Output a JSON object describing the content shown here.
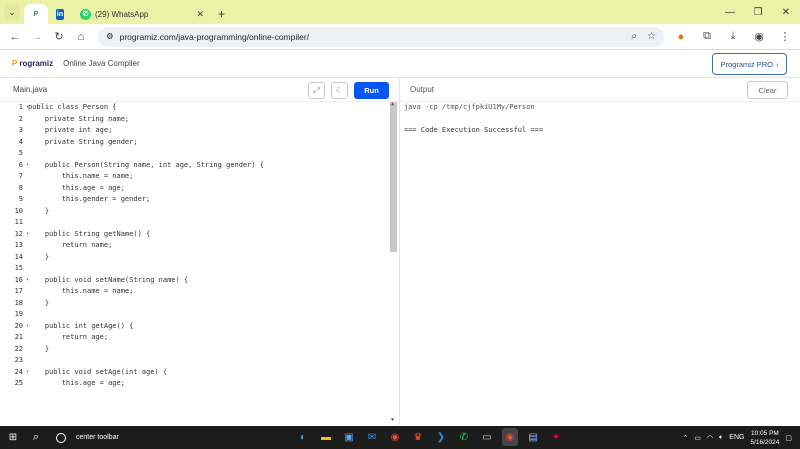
{
  "browser": {
    "tabs": [
      {
        "label": "",
        "icon": "programiz-favicon"
      },
      {
        "label": "",
        "icon": "linkedin-favicon"
      },
      {
        "label": "(29) WhatsApp",
        "icon": "whatsapp-favicon"
      }
    ],
    "new_tab": "+",
    "url": "programiz.com/java-programming/online-compiler/"
  },
  "app": {
    "logo_text": "rogramiz",
    "logo_prefix": "P",
    "title": "Online Java Compiler",
    "pro_button": "Programiz PRO",
    "pro_arrow": "›"
  },
  "editor": {
    "filename": "Main.java",
    "run_label": "Run",
    "lines": [
      {
        "n": "1",
        "fold": "▾",
        "text": "public class Person {"
      },
      {
        "n": "2",
        "fold": "",
        "text": "    private String name;"
      },
      {
        "n": "3",
        "fold": "",
        "text": "    private int age;"
      },
      {
        "n": "4",
        "fold": "",
        "text": "    private String gender;"
      },
      {
        "n": "5",
        "fold": "",
        "text": ""
      },
      {
        "n": "6",
        "fold": "▾",
        "text": "    public Person(String name, int age, String gender) {"
      },
      {
        "n": "7",
        "fold": "",
        "text": "        this.name = name;"
      },
      {
        "n": "8",
        "fold": "",
        "text": "        this.age = age;"
      },
      {
        "n": "9",
        "fold": "",
        "text": "        this.gender = gender;"
      },
      {
        "n": "10",
        "fold": "",
        "text": "    }"
      },
      {
        "n": "11",
        "fold": "",
        "text": ""
      },
      {
        "n": "12",
        "fold": "▾",
        "text": "    public String getName() {"
      },
      {
        "n": "13",
        "fold": "",
        "text": "        return name;"
      },
      {
        "n": "14",
        "fold": "",
        "text": "    }"
      },
      {
        "n": "15",
        "fold": "",
        "text": ""
      },
      {
        "n": "16",
        "fold": "▾",
        "text": "    public void setName(String name) {"
      },
      {
        "n": "17",
        "fold": "",
        "text": "        this.name = name;"
      },
      {
        "n": "18",
        "fold": "",
        "text": "    }"
      },
      {
        "n": "19",
        "fold": "",
        "text": ""
      },
      {
        "n": "20",
        "fold": "▾",
        "text": "    public int getAge() {"
      },
      {
        "n": "21",
        "fold": "",
        "text": "        return age;"
      },
      {
        "n": "22",
        "fold": "",
        "text": "    }"
      },
      {
        "n": "23",
        "fold": "",
        "text": ""
      },
      {
        "n": "24",
        "fold": "▾",
        "text": "    public void setAge(int age) {"
      },
      {
        "n": "25",
        "fold": "",
        "text": "        this.age = age;"
      }
    ]
  },
  "output": {
    "title": "Output",
    "clear_label": "Clear",
    "lines": [
      "java -cp /tmp/cjfpkiU1My/Person",
      "",
      "=== Code Execution Successful ==="
    ]
  },
  "taskbar": {
    "search_text": "center toolbar",
    "lang": "ENG",
    "time": "10:05 PM",
    "date": "5/16/2024"
  }
}
